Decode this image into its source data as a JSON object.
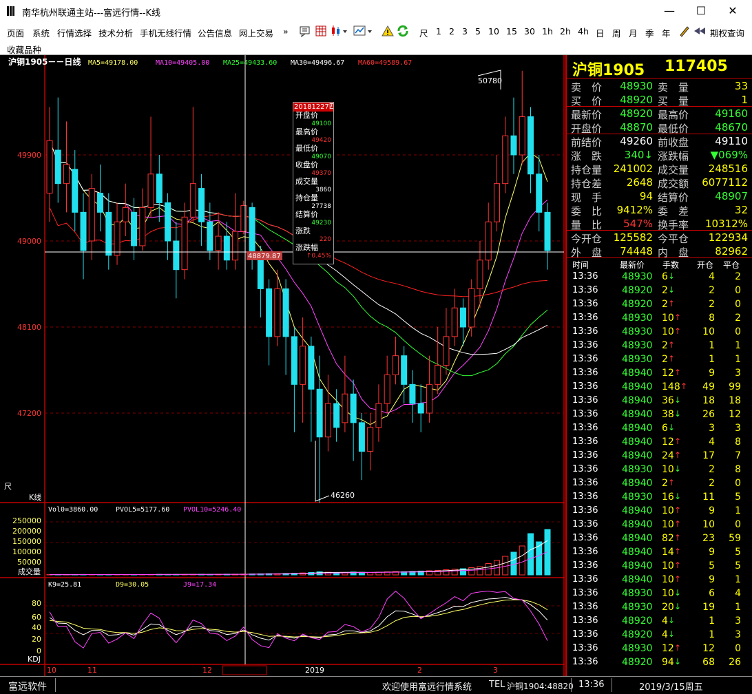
{
  "window": {
    "title": "南华杭州联通主站---富远行情--K线",
    "minimize": "—",
    "maximize": "☐",
    "close": "✕"
  },
  "menu": {
    "items": [
      "页面",
      "系统",
      "行情选择",
      "技术分析",
      "手机无线行情",
      "公告信息",
      "网上交易",
      "»"
    ],
    "periods": [
      "尺",
      "1",
      "2",
      "3",
      "5",
      "10",
      "15",
      "30",
      "1h",
      "2h",
      "4h",
      "日",
      "周",
      "月",
      "季",
      "年"
    ],
    "option_query": "期权查询"
  },
  "favorites_label": "收藏品种",
  "chart_header": {
    "title": "沪铜1905－－日线",
    "ma5": "MA5=49178.00",
    "ma10": "MA10=49405.00",
    "ma25": "MA25=49433.60",
    "ma30": "MA30=49496.67",
    "ma60": "MA60=49589.67"
  },
  "colors": {
    "up": "#ff3333",
    "down": "#22e0ee",
    "ma5": "#ffff66",
    "ma10": "#ff44ff",
    "ma25": "#33ff33",
    "ma30": "#ffffff",
    "ma60": "#ff2222",
    "axis": "#c00000",
    "yellow": "#ffff00",
    "green": "#33ff33",
    "red": "#ff3333"
  },
  "price_axis": {
    "ticks": [
      "49900",
      "49000",
      "48100",
      "47200"
    ]
  },
  "annotations": {
    "high": "50780",
    "low": "46260",
    "cursor_price": "48879.87",
    "kline_label": "K线",
    "ruler_icon": "尺"
  },
  "tooltip": {
    "date": "20181227四",
    "rows": [
      {
        "label": "开盘价",
        "value": "49100",
        "color": "#33ff33"
      },
      {
        "label": "最高价",
        "value": "49420",
        "color": "#ff3333"
      },
      {
        "label": "最低价",
        "value": "49070",
        "color": "#33ff33"
      },
      {
        "label": "收盘价",
        "value": "49370",
        "color": "#ff3333"
      },
      {
        "label": "成交量",
        "value": "3860",
        "color": "#ffffff"
      },
      {
        "label": "持仓量",
        "value": "27738",
        "color": "#ffffff"
      },
      {
        "label": "结算价",
        "value": "49230",
        "color": "#33ff33"
      },
      {
        "label": "涨跌",
        "value": "220",
        "color": "#ff3333"
      },
      {
        "label": "涨跌幅",
        "value": "↑0.45%",
        "color": "#ff3333"
      }
    ]
  },
  "volume_panel": {
    "vol": "Vol0=3860.00",
    "pvol5": "PVOL5=5177.60",
    "pvol10": "PVOL10=5246.40",
    "ticks": [
      "250000",
      "200000",
      "150000",
      "100000",
      "50000"
    ],
    "label": "成交量"
  },
  "kdj_panel": {
    "k": "K9=25.81",
    "d": "D9=30.05",
    "j": "J9=17.34",
    "ticks": [
      "80",
      "60",
      "40",
      "20",
      "0"
    ],
    "label": "KDJ"
  },
  "date_axis": {
    "labels": [
      "10",
      "11",
      "12",
      "2019",
      "2",
      "3"
    ]
  },
  "chart_data": {
    "type": "candlestick",
    "title": "沪铜1905－－日线",
    "price_range": [
      46000,
      51000
    ],
    "candles": [
      [
        49500,
        50050,
        50400,
        49200
      ],
      [
        49950,
        49600,
        50500,
        49400
      ],
      [
        49600,
        49800,
        50250,
        49300
      ],
      [
        49750,
        49300,
        49950,
        49100
      ],
      [
        49300,
        48900,
        49500,
        48600
      ],
      [
        49000,
        49550,
        49700,
        48800
      ],
      [
        49500,
        49300,
        49800,
        49100
      ],
      [
        49300,
        48850,
        49500,
        48700
      ],
      [
        48850,
        49200,
        49400,
        48750
      ],
      [
        49200,
        49350,
        49600,
        49050
      ],
      [
        49300,
        48950,
        49450,
        48800
      ],
      [
        48950,
        49350,
        49550,
        48900
      ],
      [
        49350,
        49700,
        50300,
        49250
      ],
      [
        49700,
        49400,
        49900,
        49200
      ],
      [
        49400,
        49000,
        49500,
        48800
      ],
      [
        49000,
        48700,
        49200,
        48400
      ],
      [
        48700,
        49250,
        49400,
        48600
      ],
      [
        49250,
        49600,
        50400,
        49200
      ],
      [
        49550,
        49200,
        49700,
        48950
      ],
      [
        49200,
        48900,
        49400,
        48800
      ],
      [
        48900,
        49050,
        49300,
        48700
      ],
      [
        49050,
        48800,
        49200,
        48700
      ],
      [
        48800,
        49100,
        49500,
        48700
      ],
      [
        49100,
        49370,
        49420,
        49070
      ],
      [
        49350,
        48850,
        49400,
        48700
      ],
      [
        48850,
        48500,
        48950,
        48200
      ],
      [
        48500,
        48000,
        48600,
        47700
      ],
      [
        48000,
        48500,
        48700,
        47900
      ],
      [
        48500,
        48000,
        48600,
        47600
      ],
      [
        48000,
        47500,
        48100,
        47000
      ],
      [
        47500,
        47900,
        48200,
        47100
      ],
      [
        47900,
        47450,
        48000,
        46900
      ],
      [
        47450,
        46950,
        47800,
        46260
      ],
      [
        46950,
        47300,
        47600,
        46800
      ],
      [
        47300,
        47050,
        47450,
        46900
      ],
      [
        47100,
        47400,
        47800,
        47000
      ],
      [
        47400,
        47100,
        47550,
        46700
      ],
      [
        47100,
        46800,
        47200,
        46500
      ],
      [
        46800,
        47050,
        47200,
        46600
      ],
      [
        47050,
        47300,
        47500,
        46900
      ],
      [
        47300,
        47600,
        47800,
        47200
      ],
      [
        47600,
        47800,
        48000,
        47500
      ],
      [
        47800,
        47500,
        47900,
        47300
      ],
      [
        47500,
        47300,
        47650,
        47100
      ],
      [
        47300,
        47200,
        47500,
        47000
      ],
      [
        47200,
        47500,
        47800,
        47100
      ],
      [
        47500,
        47700,
        48100,
        47400
      ],
      [
        47700,
        48000,
        48300,
        47600
      ],
      [
        48000,
        48300,
        48500,
        47900
      ],
      [
        48300,
        48100,
        48400,
        47900
      ],
      [
        48100,
        48500,
        48600,
        48000
      ],
      [
        48500,
        48800,
        49000,
        48300
      ],
      [
        48800,
        49200,
        49400,
        48700
      ],
      [
        49200,
        49600,
        49900,
        49100
      ],
      [
        49600,
        50100,
        50300,
        49500
      ],
      [
        50100,
        49900,
        50500,
        49700
      ],
      [
        49900,
        50300,
        50780,
        49800
      ],
      [
        50300,
        49700,
        50400,
        49500
      ],
      [
        49700,
        49300,
        49900,
        49100
      ],
      [
        49300,
        48900,
        49400,
        48700
      ]
    ],
    "volume": [
      1200,
      1500,
      1300,
      1800,
      2100,
      1600,
      1400,
      2000,
      1700,
      1500,
      1800,
      1600,
      2200,
      2500,
      2100,
      2400,
      1900,
      2300,
      2700,
      2000,
      3000,
      3500,
      3200,
      3860,
      4500,
      5200,
      6000,
      5800,
      7200,
      8000,
      9500,
      12000,
      15000,
      13000,
      11000,
      10500,
      14000,
      12500,
      11800,
      13200,
      14500,
      16000,
      15500,
      17000,
      18500,
      20000,
      22000,
      25000,
      28000,
      30000,
      35000,
      40000,
      55000,
      70000,
      90000,
      110000,
      140000,
      200000,
      160000,
      220000
    ],
    "ma": [
      "MA5",
      "MA10",
      "MA25",
      "MA30",
      "MA60"
    ],
    "indicator": "KDJ"
  },
  "quote": {
    "name": "沪铜1905",
    "last": "117405",
    "rows": [
      {
        "l1": "卖　价",
        "v1": "48930",
        "c1": "#33ff33",
        "l2": "卖　量",
        "v2": "33",
        "c2": "#ffff00"
      },
      {
        "l1": "买　价",
        "v1": "48920",
        "c1": "#33ff33",
        "l2": "买　量",
        "v2": "1",
        "c2": "#ffff00"
      },
      {
        "l1": "最新价",
        "v1": "48920",
        "c1": "#33ff33",
        "l2": "最高价",
        "v2": "49160",
        "c2": "#33ff33"
      },
      {
        "l1": "开盘价",
        "v1": "48870",
        "c1": "#33ff33",
        "l2": "最低价",
        "v2": "48670",
        "c2": "#33ff33"
      },
      {
        "l1": "前结价",
        "v1": "49260",
        "c1": "#ffffff",
        "l2": "前收盘",
        "v2": "49110",
        "c2": "#ffffff"
      },
      {
        "l1": "涨　跌",
        "v1": "340↓",
        "c1": "#33ff33",
        "l2": "涨跌幅",
        "v2": "▼069%",
        "c2": "#33ff33"
      },
      {
        "l1": "持仓量",
        "v1": "241002",
        "c1": "#ffff00",
        "l2": "成交量",
        "v2": "248516",
        "c2": "#ffff00"
      },
      {
        "l1": "持仓差",
        "v1": "2648",
        "c1": "#ffff00",
        "l2": "成交额",
        "v2": "6077112",
        "c2": "#ffff00"
      },
      {
        "l1": "现　手",
        "v1": "94",
        "c1": "#ffff00",
        "l2": "结算价",
        "v2": "48907",
        "c2": "#33ff33"
      },
      {
        "l1": "委　比",
        "v1": "9412%",
        "c1": "#ffff00",
        "l2": "委　差",
        "v2": "32",
        "c2": "#ffff00"
      },
      {
        "l1": "量　比",
        "v1": "547%",
        "c1": "#ff3333",
        "l2": "换手率",
        "v2": "10312%",
        "c2": "#ffff00"
      },
      {
        "l1": "今开仓",
        "v1": "125582",
        "c1": "#ffff00",
        "l2": "今平仓",
        "v2": "122934",
        "c2": "#ffff00"
      },
      {
        "l1": "外　盘",
        "v1": "74448",
        "c1": "#ffff00",
        "l2": "内　盘",
        "v2": "82962",
        "c2": "#ffff00"
      }
    ]
  },
  "ticks_header": {
    "time": "时间",
    "price": "最新价",
    "qty": "手数",
    "open": "开仓",
    "close": "平仓"
  },
  "ticks": [
    {
      "t": "13:36",
      "p": "48930",
      "q": "6",
      "d": "↓",
      "o": "4",
      "c": "2"
    },
    {
      "t": "13:36",
      "p": "48920",
      "q": "2",
      "d": "↓",
      "o": "2",
      "c": "0"
    },
    {
      "t": "13:36",
      "p": "48920",
      "q": "2",
      "d": "↑",
      "o": "2",
      "c": "0"
    },
    {
      "t": "13:36",
      "p": "48930",
      "q": "10",
      "d": "↑",
      "o": "8",
      "c": "2"
    },
    {
      "t": "13:36",
      "p": "48930",
      "q": "10",
      "d": "↑",
      "o": "10",
      "c": "0"
    },
    {
      "t": "13:36",
      "p": "48930",
      "q": "2",
      "d": "↑",
      "o": "1",
      "c": "1"
    },
    {
      "t": "13:36",
      "p": "48930",
      "q": "2",
      "d": "↑",
      "o": "1",
      "c": "1"
    },
    {
      "t": "13:36",
      "p": "48940",
      "q": "12",
      "d": "↑",
      "o": "9",
      "c": "3"
    },
    {
      "t": "13:36",
      "p": "48940",
      "q": "148",
      "d": "↑",
      "o": "49",
      "c": "99"
    },
    {
      "t": "13:36",
      "p": "48940",
      "q": "36",
      "d": "↓",
      "o": "18",
      "c": "18"
    },
    {
      "t": "13:36",
      "p": "48940",
      "q": "38",
      "d": "↓",
      "o": "26",
      "c": "12"
    },
    {
      "t": "13:36",
      "p": "48940",
      "q": "6",
      "d": "↓",
      "o": "3",
      "c": "3"
    },
    {
      "t": "13:36",
      "p": "48940",
      "q": "12",
      "d": "↑",
      "o": "4",
      "c": "8"
    },
    {
      "t": "13:36",
      "p": "48940",
      "q": "24",
      "d": "↑",
      "o": "17",
      "c": "7"
    },
    {
      "t": "13:36",
      "p": "48930",
      "q": "10",
      "d": "↓",
      "o": "2",
      "c": "8"
    },
    {
      "t": "13:36",
      "p": "48940",
      "q": "2",
      "d": "↑",
      "o": "2",
      "c": "0"
    },
    {
      "t": "13:36",
      "p": "48930",
      "q": "16",
      "d": "↓",
      "o": "11",
      "c": "5"
    },
    {
      "t": "13:36",
      "p": "48940",
      "q": "10",
      "d": "↑",
      "o": "9",
      "c": "1"
    },
    {
      "t": "13:36",
      "p": "48940",
      "q": "10",
      "d": "↑",
      "o": "10",
      "c": "0"
    },
    {
      "t": "13:36",
      "p": "48940",
      "q": "82",
      "d": "↑",
      "o": "23",
      "c": "59"
    },
    {
      "t": "13:36",
      "p": "48940",
      "q": "14",
      "d": "↑",
      "o": "9",
      "c": "5"
    },
    {
      "t": "13:36",
      "p": "48940",
      "q": "10",
      "d": "↑",
      "o": "5",
      "c": "5"
    },
    {
      "t": "13:36",
      "p": "48940",
      "q": "10",
      "d": "↑",
      "o": "9",
      "c": "1"
    },
    {
      "t": "13:36",
      "p": "48930",
      "q": "10",
      "d": "↓",
      "o": "6",
      "c": "4"
    },
    {
      "t": "13:36",
      "p": "48930",
      "q": "20",
      "d": "↓",
      "o": "19",
      "c": "1"
    },
    {
      "t": "13:36",
      "p": "48920",
      "q": "4",
      "d": "↓",
      "o": "1",
      "c": "3"
    },
    {
      "t": "13:36",
      "p": "48920",
      "q": "4",
      "d": "↓",
      "o": "1",
      "c": "3"
    },
    {
      "t": "13:36",
      "p": "48930",
      "q": "12",
      "d": "↑",
      "o": "12",
      "c": "0"
    },
    {
      "t": "13:36",
      "p": "48920",
      "q": "94",
      "d": "↓",
      "o": "68",
      "c": "26"
    }
  ],
  "status": {
    "brand": "富远软件",
    "welcome": "欢迎使用富远行情系统",
    "tel": "TEL",
    "ticker": "沪铜1904:48820",
    "time": "13:36",
    "date": "2019/3/15周五"
  }
}
